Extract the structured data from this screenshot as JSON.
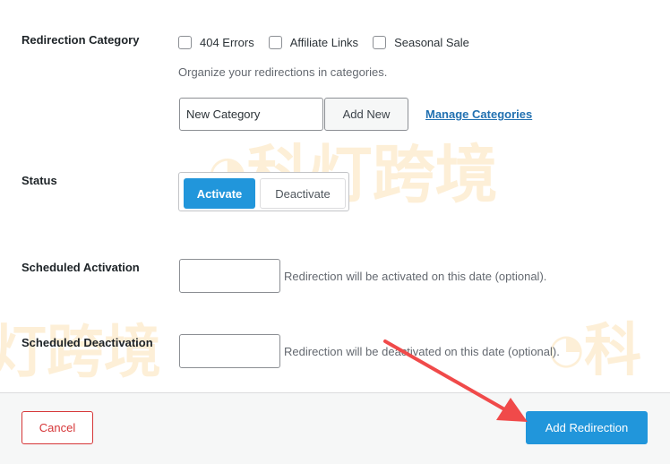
{
  "fields": {
    "category": {
      "label": "Redirection Category",
      "options": [
        {
          "label": "404 Errors",
          "checked": false
        },
        {
          "label": "Affiliate Links",
          "checked": false
        },
        {
          "label": "Seasonal Sale",
          "checked": false
        }
      ],
      "help": "Organize your redirections in categories.",
      "new_category_placeholder": "New Category",
      "add_new_label": "Add New",
      "manage_link": "Manage Categories"
    },
    "status": {
      "label": "Status",
      "activate_label": "Activate",
      "deactivate_label": "Deactivate",
      "selected": "Activate"
    },
    "scheduled_activation": {
      "label": "Scheduled Activation",
      "value": "",
      "help": "Redirection will be activated on this date (optional)."
    },
    "scheduled_deactivation": {
      "label": "Scheduled Deactivation",
      "value": "",
      "help": "Redirection will be deactivated on this date (optional)."
    }
  },
  "footer": {
    "cancel_label": "Cancel",
    "submit_label": "Add Redirection"
  },
  "watermark": {
    "text_1": "科灯跨境",
    "text_2": "灯跨境",
    "text_3": "科"
  },
  "colors": {
    "primary": "#2196db",
    "danger": "#d63638",
    "link": "#2271b1",
    "arrow": "#f04a4a",
    "watermark": "#f5a623"
  }
}
